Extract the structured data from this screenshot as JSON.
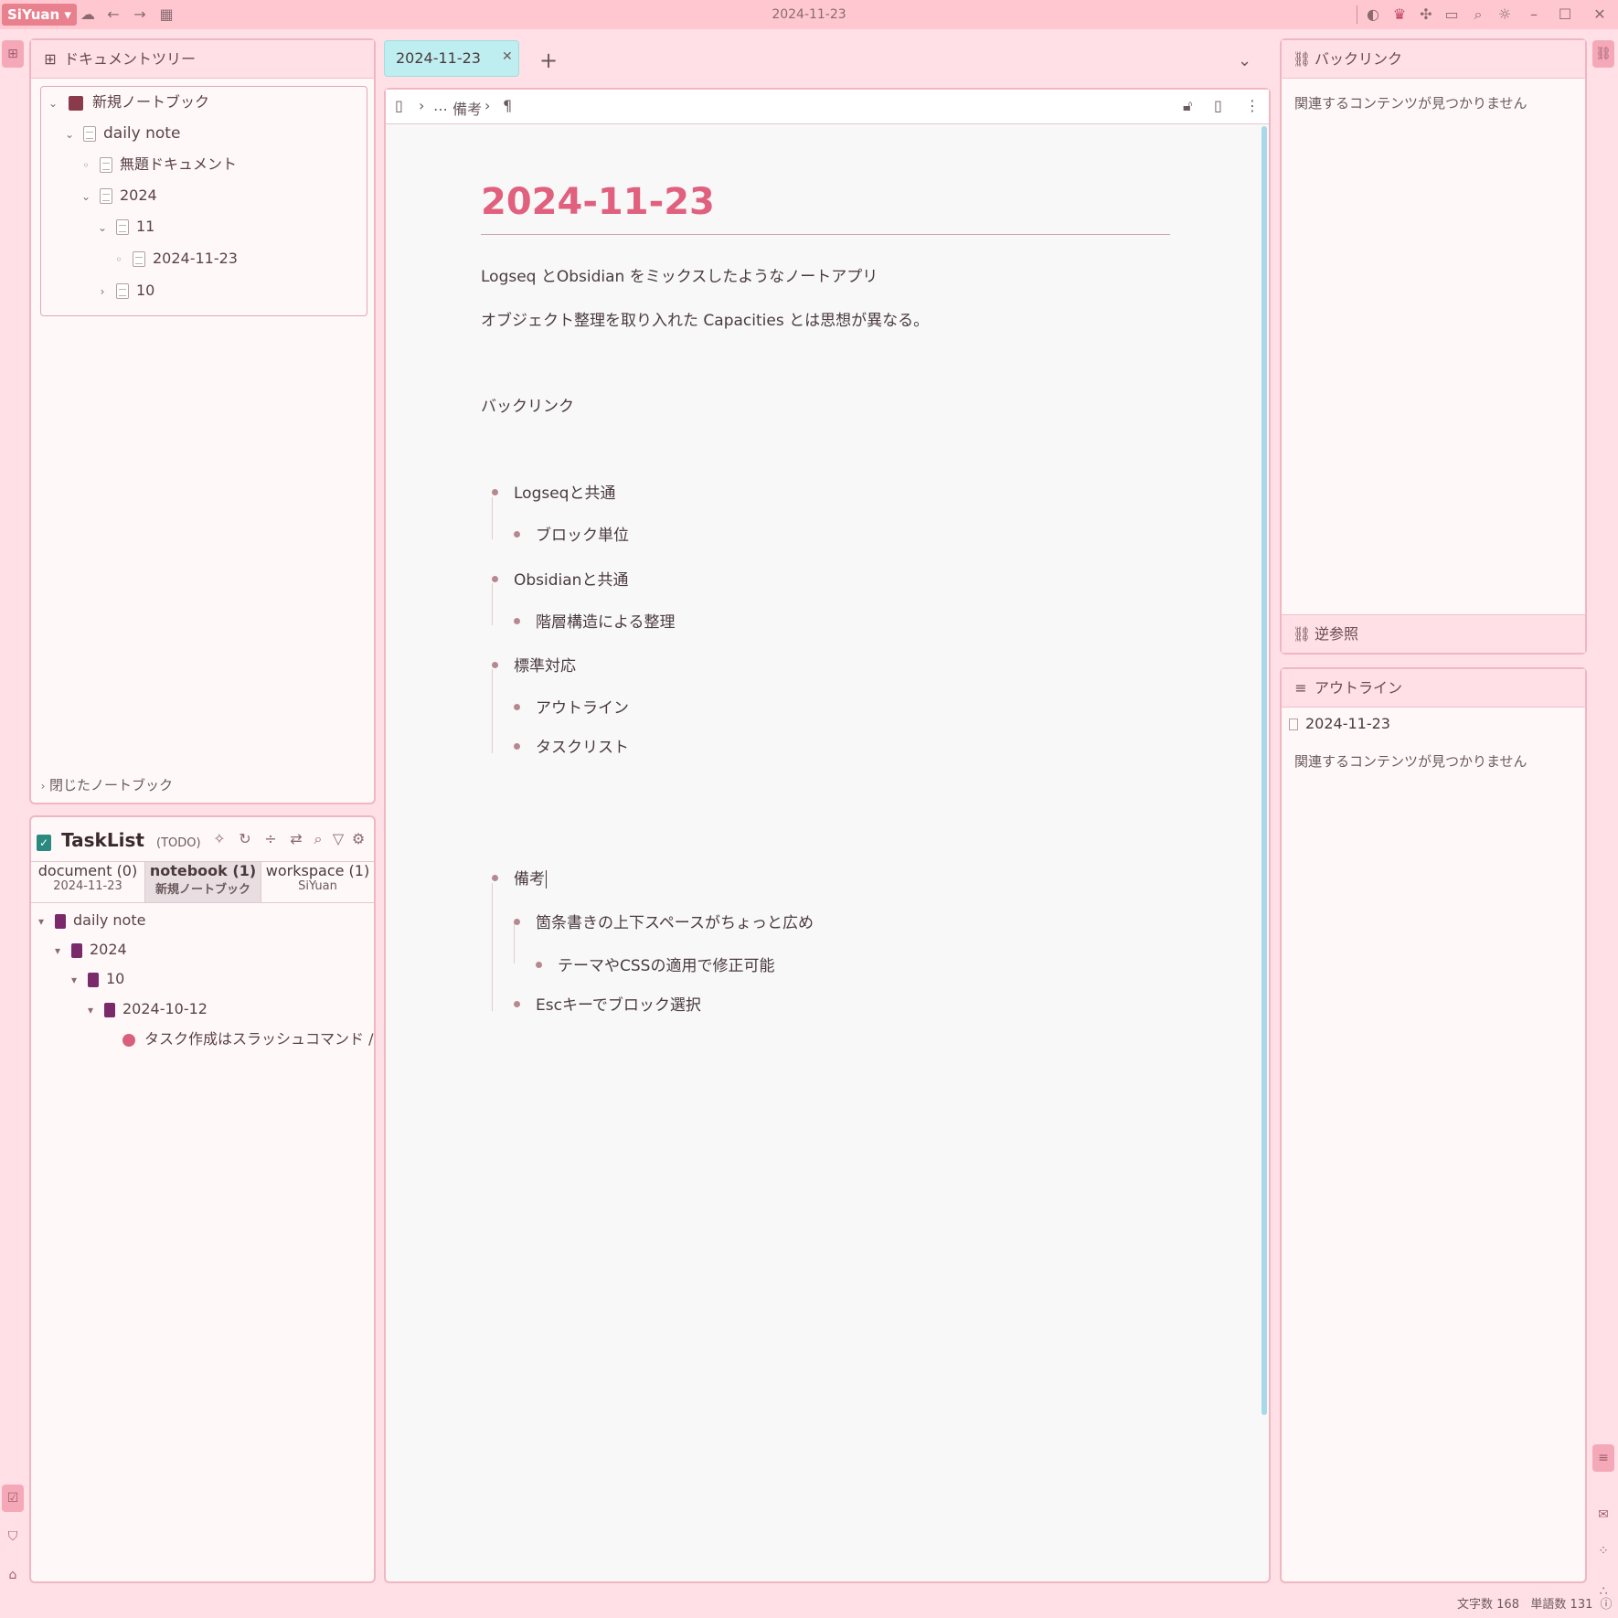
{
  "app": {
    "brand": "SiYuan",
    "window_title": "2024-11-23"
  },
  "doc_tree": {
    "title": "ドキュメントツリー",
    "notebook": "新規ノートブック",
    "items": [
      "daily note",
      "無題ドキュメント",
      "2024",
      "11",
      "2024-11-23",
      "10"
    ],
    "closed_notebooks": "閉じたノートブック"
  },
  "tasklist": {
    "title": "TaskList",
    "mode": "(TODO)",
    "tabs": [
      {
        "label": "document (0)",
        "sub": "2024-11-23"
      },
      {
        "label": "notebook (1)",
        "sub": "新規ノートブック"
      },
      {
        "label": "workspace (1)",
        "sub": "SiYuan"
      }
    ],
    "tree": [
      "daily note",
      "2024",
      "10",
      "2024-10-12"
    ],
    "task": "タスク作成はスラッシュコマンド /task #T..."
  },
  "editor": {
    "tab_label": "2024-11-23",
    "breadcrumb": {
      "item": "備考",
      "pilcrow": "¶"
    },
    "title": "2024-11-23",
    "paragraphs": [
      "Logseq とObsidian をミックスしたようなノートアプリ",
      "オブジェクト整理を取り入れた Capacities とは思想が異なる。",
      "バックリンク"
    ],
    "bullets": [
      "Logseqと共通",
      "ブロック単位",
      "Obsidianと共通",
      "階層構造による整理",
      "標準対応",
      "アウトライン",
      "タスクリスト",
      "備考",
      "箇条書きの上下スペースがちょっと広め",
      "テーマやCSSの適用で修正可能",
      "Escキーでブロック選択"
    ]
  },
  "backlink_panel": {
    "title": "バックリンク",
    "empty": "関連するコンテンツが見つかりません",
    "mentions": "逆参照"
  },
  "outline_panel": {
    "title": "アウトライン",
    "doc": "2024-11-23",
    "empty": "関連するコンテンツが見つかりません"
  },
  "status": {
    "chars_label": "文字数",
    "chars": "168",
    "words_label": "単語数",
    "words": "131"
  },
  "colors": {
    "accent": "#e0607e",
    "bg": "#ffe0e6",
    "tab": "#bfeef0"
  }
}
